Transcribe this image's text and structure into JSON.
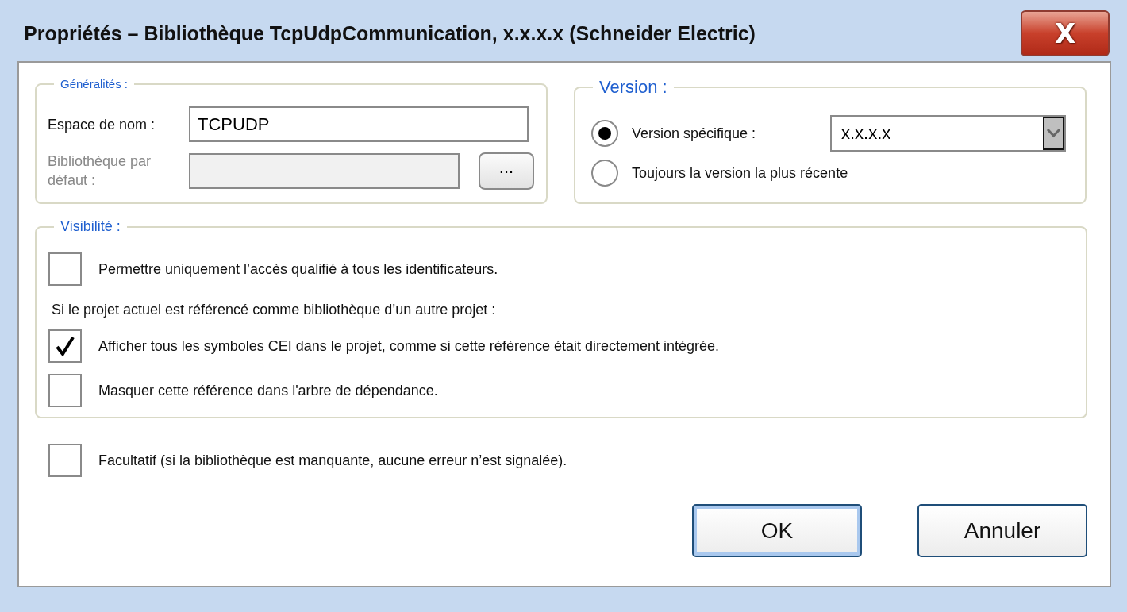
{
  "window": {
    "title": "Propriétés – Bibliothèque TcpUdpCommunication, x.x.x.x (Schneider Electric)",
    "close_label": "X"
  },
  "general": {
    "legend": "Généralités :",
    "fields": [
      {
        "label": "Espace de nom :",
        "value": "TCPUDP",
        "disabled": false
      },
      {
        "label": "Bibliothèque par défaut :",
        "disabled": true,
        "browse_label": "..."
      }
    ]
  },
  "version": {
    "legend": "Version :",
    "options": [
      {
        "label": "Version spécifique :",
        "selected": true,
        "dropdown": {
          "value": "x.x.x.x"
        }
      },
      {
        "label": "Toujours la version la plus récente",
        "selected": false
      }
    ]
  },
  "visibility": {
    "legend": "Visibilité :",
    "items": [
      {
        "kind": "checkbox",
        "label": "Permettre uniquement l’accès qualifié à tous les identificateurs.",
        "checked": false
      },
      {
        "kind": "note",
        "label": "Si le projet actuel est référencé comme bibliothèque d’un autre projet :"
      },
      {
        "kind": "checkbox",
        "label": "Afficher tous les symboles CEI dans le projet, comme si cette référence était directement intégrée.",
        "checked": true
      },
      {
        "kind": "checkbox",
        "label": "Masquer cette référence dans l'arbre de dépendance.",
        "checked": false
      }
    ]
  },
  "optional": {
    "label": "Facultatif (si la bibliothèque est manquante, aucune erreur n’est signalée).",
    "checked": false
  },
  "buttons": [
    {
      "label": "OK",
      "default": true
    },
    {
      "label": "Annuler",
      "default": false
    }
  ]
}
